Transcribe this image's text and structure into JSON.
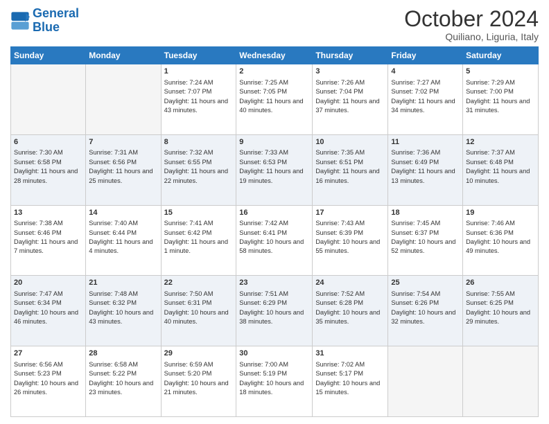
{
  "header": {
    "logo": {
      "line1": "General",
      "line2": "Blue"
    },
    "month": "October 2024",
    "location": "Quiliano, Liguria, Italy"
  },
  "columns": [
    "Sunday",
    "Monday",
    "Tuesday",
    "Wednesday",
    "Thursday",
    "Friday",
    "Saturday"
  ],
  "weeks": [
    [
      {
        "day": "",
        "info": ""
      },
      {
        "day": "",
        "info": ""
      },
      {
        "day": "1",
        "sunrise": "7:24 AM",
        "sunset": "7:07 PM",
        "daylight": "11 hours and 43 minutes."
      },
      {
        "day": "2",
        "sunrise": "7:25 AM",
        "sunset": "7:05 PM",
        "daylight": "11 hours and 40 minutes."
      },
      {
        "day": "3",
        "sunrise": "7:26 AM",
        "sunset": "7:04 PM",
        "daylight": "11 hours and 37 minutes."
      },
      {
        "day": "4",
        "sunrise": "7:27 AM",
        "sunset": "7:02 PM",
        "daylight": "11 hours and 34 minutes."
      },
      {
        "day": "5",
        "sunrise": "7:29 AM",
        "sunset": "7:00 PM",
        "daylight": "11 hours and 31 minutes."
      }
    ],
    [
      {
        "day": "6",
        "sunrise": "7:30 AM",
        "sunset": "6:58 PM",
        "daylight": "11 hours and 28 minutes."
      },
      {
        "day": "7",
        "sunrise": "7:31 AM",
        "sunset": "6:56 PM",
        "daylight": "11 hours and 25 minutes."
      },
      {
        "day": "8",
        "sunrise": "7:32 AM",
        "sunset": "6:55 PM",
        "daylight": "11 hours and 22 minutes."
      },
      {
        "day": "9",
        "sunrise": "7:33 AM",
        "sunset": "6:53 PM",
        "daylight": "11 hours and 19 minutes."
      },
      {
        "day": "10",
        "sunrise": "7:35 AM",
        "sunset": "6:51 PM",
        "daylight": "11 hours and 16 minutes."
      },
      {
        "day": "11",
        "sunrise": "7:36 AM",
        "sunset": "6:49 PM",
        "daylight": "11 hours and 13 minutes."
      },
      {
        "day": "12",
        "sunrise": "7:37 AM",
        "sunset": "6:48 PM",
        "daylight": "11 hours and 10 minutes."
      }
    ],
    [
      {
        "day": "13",
        "sunrise": "7:38 AM",
        "sunset": "6:46 PM",
        "daylight": "11 hours and 7 minutes."
      },
      {
        "day": "14",
        "sunrise": "7:40 AM",
        "sunset": "6:44 PM",
        "daylight": "11 hours and 4 minutes."
      },
      {
        "day": "15",
        "sunrise": "7:41 AM",
        "sunset": "6:42 PM",
        "daylight": "11 hours and 1 minute."
      },
      {
        "day": "16",
        "sunrise": "7:42 AM",
        "sunset": "6:41 PM",
        "daylight": "10 hours and 58 minutes."
      },
      {
        "day": "17",
        "sunrise": "7:43 AM",
        "sunset": "6:39 PM",
        "daylight": "10 hours and 55 minutes."
      },
      {
        "day": "18",
        "sunrise": "7:45 AM",
        "sunset": "6:37 PM",
        "daylight": "10 hours and 52 minutes."
      },
      {
        "day": "19",
        "sunrise": "7:46 AM",
        "sunset": "6:36 PM",
        "daylight": "10 hours and 49 minutes."
      }
    ],
    [
      {
        "day": "20",
        "sunrise": "7:47 AM",
        "sunset": "6:34 PM",
        "daylight": "10 hours and 46 minutes."
      },
      {
        "day": "21",
        "sunrise": "7:48 AM",
        "sunset": "6:32 PM",
        "daylight": "10 hours and 43 minutes."
      },
      {
        "day": "22",
        "sunrise": "7:50 AM",
        "sunset": "6:31 PM",
        "daylight": "10 hours and 40 minutes."
      },
      {
        "day": "23",
        "sunrise": "7:51 AM",
        "sunset": "6:29 PM",
        "daylight": "10 hours and 38 minutes."
      },
      {
        "day": "24",
        "sunrise": "7:52 AM",
        "sunset": "6:28 PM",
        "daylight": "10 hours and 35 minutes."
      },
      {
        "day": "25",
        "sunrise": "7:54 AM",
        "sunset": "6:26 PM",
        "daylight": "10 hours and 32 minutes."
      },
      {
        "day": "26",
        "sunrise": "7:55 AM",
        "sunset": "6:25 PM",
        "daylight": "10 hours and 29 minutes."
      }
    ],
    [
      {
        "day": "27",
        "sunrise": "6:56 AM",
        "sunset": "5:23 PM",
        "daylight": "10 hours and 26 minutes."
      },
      {
        "day": "28",
        "sunrise": "6:58 AM",
        "sunset": "5:22 PM",
        "daylight": "10 hours and 23 minutes."
      },
      {
        "day": "29",
        "sunrise": "6:59 AM",
        "sunset": "5:20 PM",
        "daylight": "10 hours and 21 minutes."
      },
      {
        "day": "30",
        "sunrise": "7:00 AM",
        "sunset": "5:19 PM",
        "daylight": "10 hours and 18 minutes."
      },
      {
        "day": "31",
        "sunrise": "7:02 AM",
        "sunset": "5:17 PM",
        "daylight": "10 hours and 15 minutes."
      },
      {
        "day": "",
        "info": ""
      },
      {
        "day": "",
        "info": ""
      }
    ]
  ]
}
